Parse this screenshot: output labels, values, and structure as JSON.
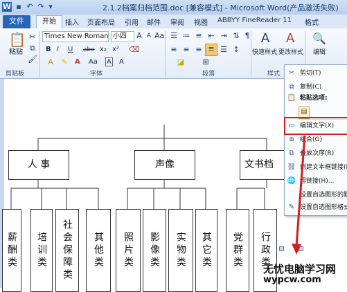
{
  "window": {
    "title": "2.1.2档案归档范围.doc [兼容模式] - Microsoft Word(产品激活失败)"
  },
  "quick_access": [
    "word-icon",
    "save-icon",
    "undo-icon",
    "redo-icon",
    "customize-icon"
  ],
  "tabs": [
    "文件",
    "开始",
    "插入",
    "页面布局",
    "引用",
    "邮件",
    "审阅",
    "视图",
    "ABBYY FineReader 11",
    "格式"
  ],
  "clipboard": {
    "paste_label": "粘贴",
    "group_label": "剪贴板"
  },
  "font": {
    "name": "Times New Roman",
    "size": "小四",
    "group_label": "字体",
    "buttons": [
      "B",
      "I",
      "U",
      "abe",
      "x₂",
      "x²",
      "A",
      "Aa",
      "A",
      "A"
    ]
  },
  "paragraph": {
    "group_label": "段落"
  },
  "styles": {
    "quick_styles": "快速样式",
    "change_styles": "更改样式",
    "group_label": "样式"
  },
  "editing": {
    "label": "编辑"
  },
  "chart": {
    "level1": [
      {
        "text": "人 事"
      },
      {
        "text": "声像"
      },
      {
        "text": "文书档"
      }
    ],
    "level2": [
      {
        "text": "薪酬类"
      },
      {
        "text": "培训类"
      },
      {
        "text": "社会保障类"
      },
      {
        "text": "其他类"
      },
      {
        "text": "照片类"
      },
      {
        "text": "影像类"
      },
      {
        "text": "实物类"
      },
      {
        "text": "其它类"
      },
      {
        "text": "党群类"
      },
      {
        "text": "行政类"
      }
    ]
  },
  "context_menu": {
    "items": [
      {
        "label": "剪切(T)",
        "icon": "scissors-icon"
      },
      {
        "label": "复制(C)",
        "icon": "copy-icon"
      },
      {
        "label": "粘贴选项:",
        "icon": "paste-icon"
      },
      {
        "label": "",
        "icon": "paste-option-icon"
      },
      {
        "label": "编辑文字(X)",
        "icon": "edit-text-icon"
      },
      {
        "label": "组合(G)",
        "icon": "group-icon"
      },
      {
        "label": "叠放次序(R)",
        "icon": "order-icon"
      },
      {
        "label": "创建文本框链接(R)",
        "icon": "textbox-link-icon"
      },
      {
        "label": "超链接(H)...",
        "icon": "hyperlink-icon"
      },
      {
        "label": "设置自选图形的默",
        "icon": "default-shape-icon"
      },
      {
        "label": "设置自选图形格式",
        "icon": "format-shape-icon"
      }
    ]
  },
  "watermark": {
    "line1": "无忧电脑学习网",
    "line2": "wypcw.com"
  },
  "colors": {
    "accent": "#2a64b7",
    "highlight": "#d21e1e"
  }
}
